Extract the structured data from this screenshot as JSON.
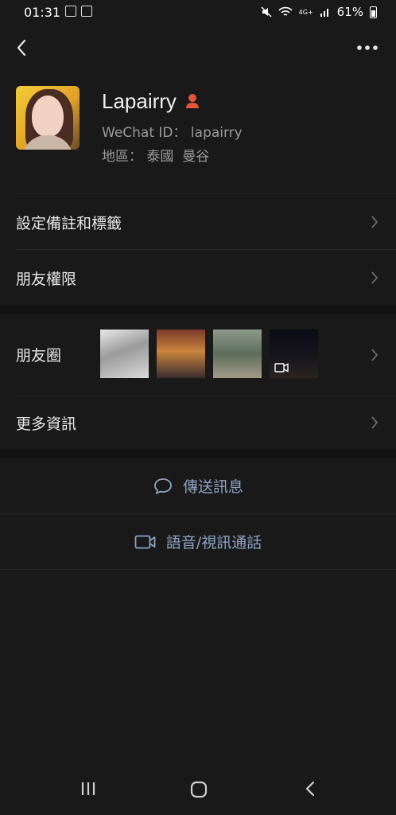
{
  "status_bar": {
    "time": "01:31",
    "battery": "61%",
    "network": "4G+"
  },
  "profile": {
    "nickname": "Lapairry",
    "wechat_id_label": "WeChat ID：",
    "wechat_id": "lapairry",
    "region_label": "地區：",
    "region": "泰國  曼谷",
    "gender_icon_color": "#e5553a"
  },
  "menu": {
    "remark_tags": "設定備註和標籤",
    "friend_permissions": "朋友權限",
    "moments": "朋友圈",
    "more_info": "更多資訊"
  },
  "actions": {
    "send_message": "傳送訊息",
    "voice_video_call": "語音/視訊通話"
  },
  "colors": {
    "background": "#191919",
    "action_text": "#8da4c4",
    "secondary_text": "#9a9a9a"
  }
}
